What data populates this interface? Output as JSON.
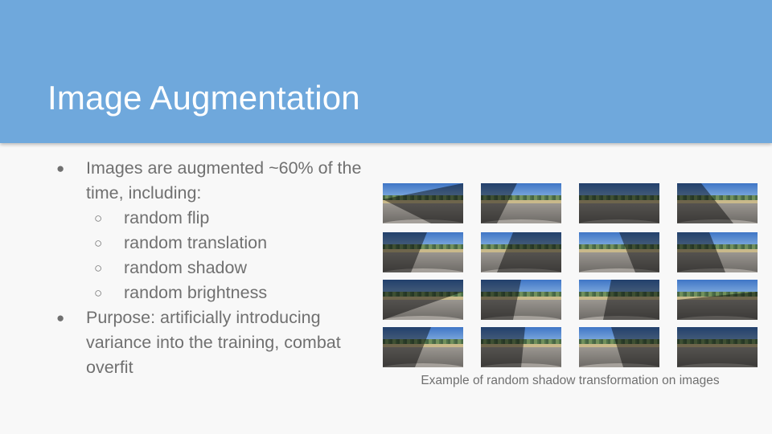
{
  "slide": {
    "title": "Image Augmentation",
    "bullets": [
      {
        "text": "Images are augmented ~60% of the time, including:",
        "sub": [
          "random flip",
          "random translation",
          "random shadow",
          "random brightness"
        ]
      },
      {
        "text": "Purpose: artificially introducing variance into the training, combat overfit",
        "sub": []
      }
    ],
    "figure": {
      "caption": "Example of random shadow transformation on images",
      "rows": 4,
      "cols": 4
    }
  }
}
